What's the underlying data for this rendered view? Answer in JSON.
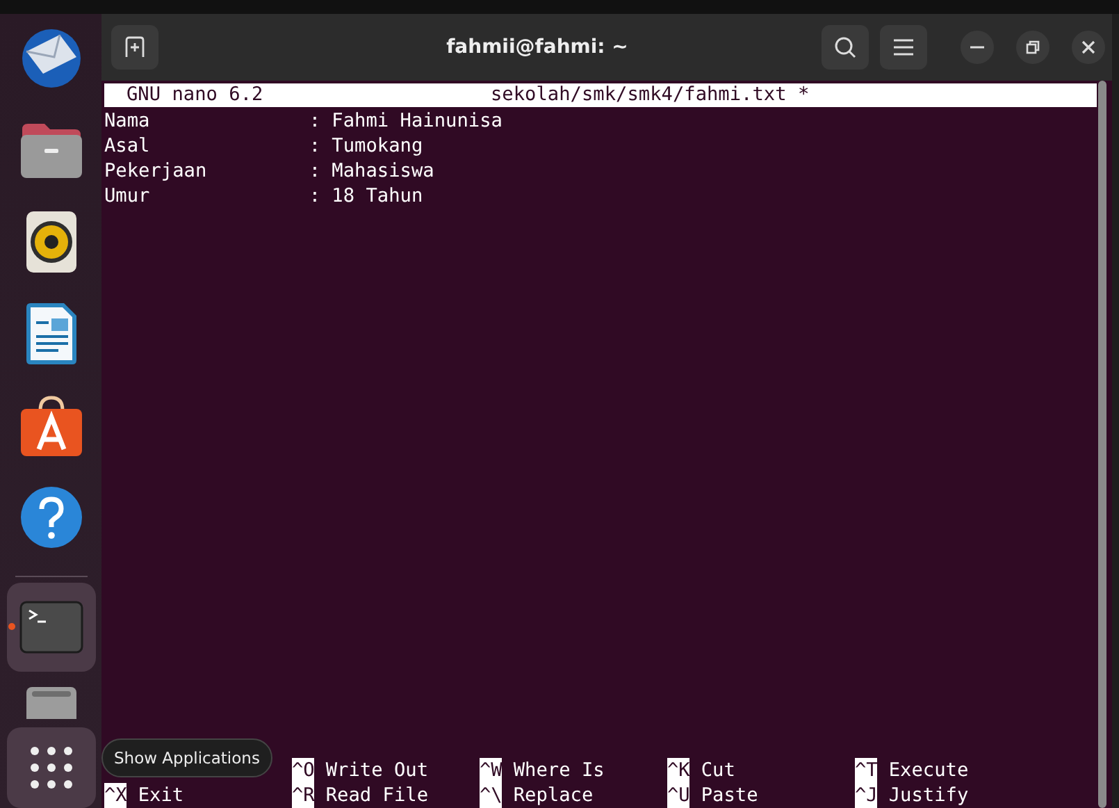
{
  "window": {
    "title": "fahmii@fahmi: ~"
  },
  "dock": {
    "items": [
      {
        "kind": "mail",
        "running": false
      },
      {
        "kind": "files",
        "running": false
      },
      {
        "kind": "speaker",
        "running": false
      },
      {
        "kind": "writer",
        "running": false
      },
      {
        "kind": "store",
        "running": false
      },
      {
        "kind": "help",
        "running": false
      },
      {
        "kind": "terminal",
        "running": true
      },
      {
        "kind": "drive",
        "running": false
      }
    ],
    "apps_tooltip": "Show Applications"
  },
  "nano": {
    "version": "GNU nano 6.2",
    "file": "sekolah/smk/smk4/fahmi.txt *",
    "lines": [
      "Nama              : Fahmi Hainunisa",
      "Asal              : Tumokang",
      "Pekerjaan         : Mahasiswa",
      "Umur              : 18 Tahun"
    ],
    "shortcut_rows": [
      [
        null,
        {
          "key": "^O",
          "label": "Write Out"
        },
        {
          "key": "^W",
          "label": "Where Is"
        },
        {
          "key": "^K",
          "label": "Cut"
        },
        {
          "key": "^T",
          "label": "Execute"
        }
      ],
      [
        {
          "key": "^X",
          "label": "Exit"
        },
        {
          "key": "^R",
          "label": "Read File"
        },
        {
          "key": "^\\",
          "label": "Replace"
        },
        {
          "key": "^U",
          "label": "Paste"
        },
        {
          "key": "^J",
          "label": "Justify"
        }
      ]
    ]
  }
}
